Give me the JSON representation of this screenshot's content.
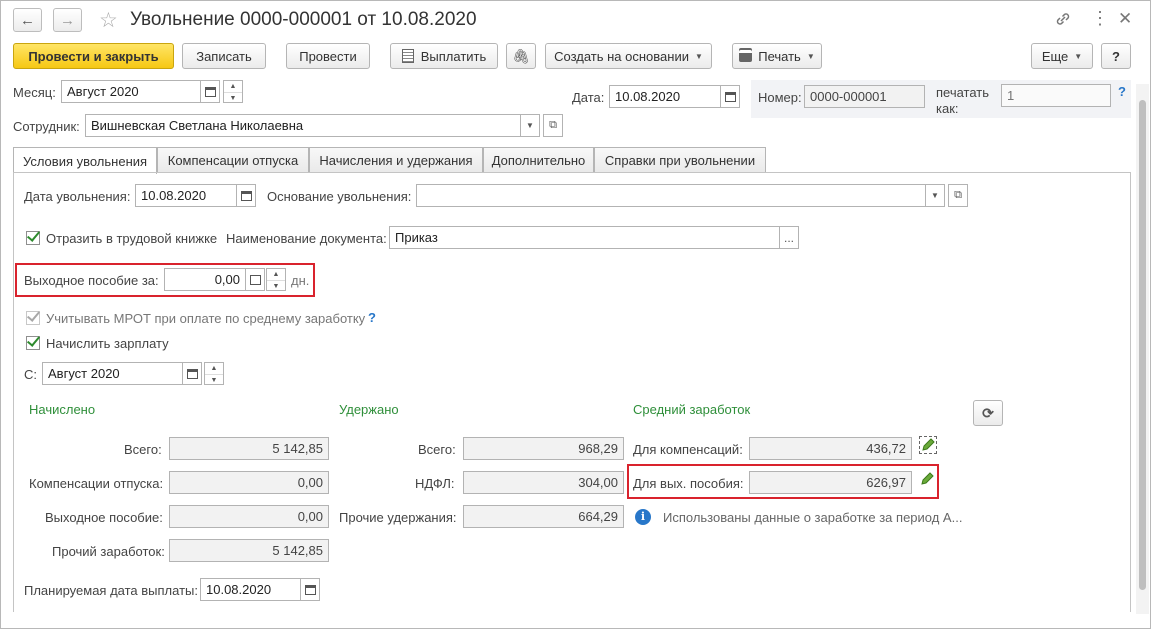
{
  "window": {
    "title": "Увольнение 0000-000001 от 10.08.2020",
    "nav_back": "←",
    "nav_forward": "→"
  },
  "toolbar": {
    "post_close": "Провести и закрыть",
    "save": "Записать",
    "post": "Провести",
    "pay": "Выплатить",
    "create_based": "Создать на основании",
    "print": "Печать",
    "more": "Еще",
    "help": "?"
  },
  "header": {
    "month_label": "Месяц:",
    "month_value": "Август 2020",
    "date_label": "Дата:",
    "date_value": "10.08.2020",
    "number_label": "Номер:",
    "number_value": "0000-000001",
    "print_as_label_1": "печатать",
    "print_as_label_2": "как:",
    "print_as_placeholder": "1",
    "help_mark": "?",
    "employee_label": "Сотрудник:",
    "employee_value": "Вишневская Светлана Николаевна"
  },
  "tabs": [
    {
      "label": "Условия увольнения"
    },
    {
      "label": "Компенсации отпуска"
    },
    {
      "label": "Начисления и удержания"
    },
    {
      "label": "Дополнительно"
    },
    {
      "label": "Справки при увольнении"
    }
  ],
  "conditions": {
    "dismissal_date_label": "Дата увольнения:",
    "dismissal_date_value": "10.08.2020",
    "reason_label": "Основание увольнения:",
    "reason_value": "",
    "workbook_label": "Отразить в трудовой книжке",
    "doc_name_label": "Наименование документа:",
    "doc_name_value": "Приказ",
    "severance_label": "Выходное пособие за:",
    "severance_value": "0,00",
    "severance_unit": "дн.",
    "mrot_label": "Учитывать МРОТ при оплате по среднему заработку",
    "mrot_help": "?",
    "calc_salary_label": "Начислить зарплату",
    "from_label": "С:",
    "from_value": "Август 2020",
    "ellipsis": "..."
  },
  "accrued": {
    "title": "Начислено",
    "total_label": "Всего:",
    "total_value": "5 142,85",
    "vacation_comp_label": "Компенсации отпуска:",
    "vacation_comp_value": "0,00",
    "severance_label": "Выходное пособие:",
    "severance_value": "0,00",
    "other_label": "Прочий заработок:",
    "other_value": "5 142,85"
  },
  "withheld": {
    "title": "Удержано",
    "total_label": "Всего:",
    "total_value": "968,29",
    "ndfl_label": "НДФЛ:",
    "ndfl_value": "304,00",
    "other_label": "Прочие удержания:",
    "other_value": "664,29"
  },
  "average": {
    "title": "Средний заработок",
    "comp_label": "Для компенсаций:",
    "comp_value": "436,72",
    "severance_label": "Для вых. пособия:",
    "severance_value": "626,97",
    "info_text": "Использованы данные о заработке за период А..."
  },
  "payment": {
    "planned_date_label": "Планируемая дата выплаты:",
    "planned_date_value": "10.08.2020"
  },
  "colors": {
    "primary_button": "#f6c814",
    "section_title": "#2f8f3a",
    "highlight": "#d9232d",
    "info": "#2877c9"
  }
}
